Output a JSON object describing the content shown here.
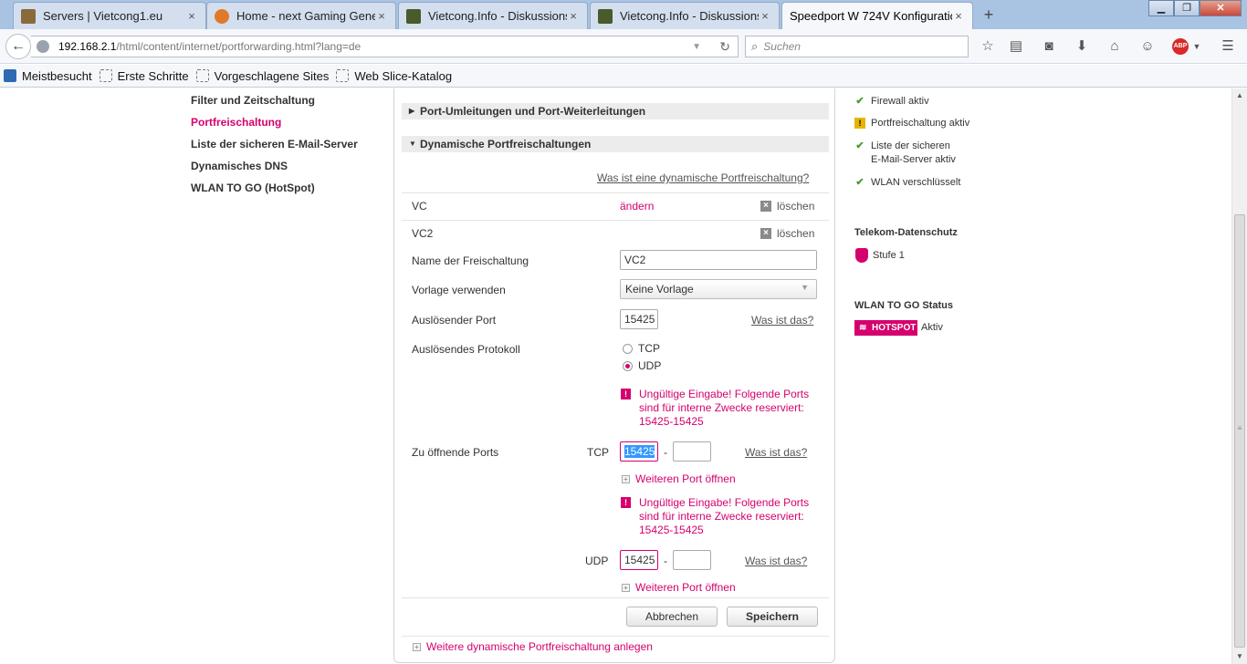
{
  "browser": {
    "tabs": [
      {
        "title": "Servers | Vietcong1.eu",
        "active": false
      },
      {
        "title": "Home - next Gaming Gene...",
        "active": false
      },
      {
        "title": "Vietcong.Info - Diskussions...",
        "active": false
      },
      {
        "title": "Vietcong.Info - Diskussions...",
        "active": false
      },
      {
        "title": "Speedport W 724V Konfiguratio...",
        "active": true
      }
    ],
    "tab_close_glyph": "×",
    "new_tab_glyph": "+",
    "url_host": "192.168.2.1",
    "url_path": "/html/content/internet/portforwarding.html?lang=de",
    "search_placeholder": "Suchen",
    "abp_label": "ABP",
    "bookmarks": [
      "Meistbesucht",
      "Erste Schritte",
      "Vorgeschlagene Sites",
      "Web Slice-Katalog"
    ]
  },
  "sidebar": {
    "items": [
      {
        "label": "Filter und Zeitschaltung",
        "active": false
      },
      {
        "label": "Portfreischaltung",
        "active": true
      },
      {
        "label": "Liste der sicheren E-Mail-Server",
        "active": false
      },
      {
        "label": "Dynamisches DNS",
        "active": false
      },
      {
        "label": "WLAN TO GO (HotSpot)",
        "active": false
      }
    ]
  },
  "panel": {
    "section_port_umleitungen": "Port-Umleitungen und Port-Weiterleitungen",
    "section_dynamic": "Dynamische Portfreischaltungen",
    "help_link": "Was ist eine dynamische Portfreischaltung?",
    "entries": [
      {
        "name": "VC",
        "edit_label": "ändern",
        "delete_label": "löschen"
      },
      {
        "name": "VC2",
        "delete_label": "löschen"
      }
    ],
    "form": {
      "name_label": "Name der Freischaltung",
      "name_value": "VC2",
      "template_label": "Vorlage verwenden",
      "template_value": "Keine Vorlage",
      "trigger_port_label": "Auslösender Port",
      "trigger_port_value": "15425",
      "what_is_this": "Was ist das?",
      "protocol_label": "Auslösendes Protokoll",
      "protocol_tcp": "TCP",
      "protocol_udp": "UDP",
      "protocol_selected": "UDP",
      "error_line1": "Ungültige Eingabe! Folgende Ports",
      "error_line2": "sind für interne Zwecke reserviert:",
      "error_line3": "15425-15425",
      "open_ports_label": "Zu öffnende Ports",
      "tcp_label": "TCP",
      "tcp_from": "15425",
      "tcp_to": "",
      "udp_label": "UDP",
      "udp_from": "15425",
      "udp_to": "",
      "range_dash": "-",
      "more_ports": "Weiteren Port öffnen",
      "cancel": "Abbrechen",
      "save": "Speichern"
    },
    "add_more": "Weitere dynamische Portfreischaltung anlegen"
  },
  "status": {
    "items": [
      {
        "icon": "check-icon",
        "lines": [
          "Firewall aktiv"
        ]
      },
      {
        "icon": "warning-icon",
        "lines": [
          "Portfreischaltung aktiv"
        ]
      },
      {
        "icon": "check-icon",
        "lines": [
          "Liste der sicheren",
          "E-Mail-Server aktiv"
        ]
      },
      {
        "icon": "check-icon",
        "lines": [
          "WLAN verschlüsselt"
        ]
      }
    ],
    "privacy_heading": "Telekom-Datenschutz",
    "privacy_level": "Stufe 1",
    "wlan_heading": "WLAN TO GO Status",
    "hotspot_badge": "HOTSPOT",
    "hotspot_state": "Aktiv"
  },
  "colors": {
    "accent": "#d5006d",
    "ok": "#4a9b2a",
    "warn": "#e8b400"
  }
}
